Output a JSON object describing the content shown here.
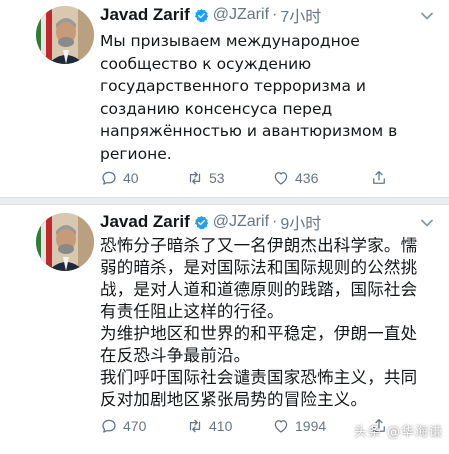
{
  "tweets": [
    {
      "author": {
        "name": "Javad Zarif",
        "handle": "@JZarif",
        "separator": "·",
        "time": "7小时"
      },
      "text": "Мы призываем международное\nсообщество к осуждению\nгосударственного терроризма и\nсозданию консенсуса перед\nнапряжённостью и авантюризмом в\nрегионе.",
      "counts": {
        "replies": "40",
        "retweets": "53",
        "likes": "436"
      }
    },
    {
      "author": {
        "name": "Javad Zarif",
        "handle": "@JZarif",
        "separator": "·",
        "time": "9小时"
      },
      "text": "恐怖分子暗杀了又一名伊朗杰出科学家。懦\n弱的暗杀，是对国际法和国际规则的公然挑\n战，是对人道和道德原则的践踏，国际社会\n有责任阻止这样的行径。\n为维护地区和世界的和平稳定，伊朗一直处\n在反恐斗争最前沿。\n我们呼吁国际社会谴责国家恐怖主义，共同\n反对加剧地区紧张局势的冒险主义。",
      "counts": {
        "replies": "470",
        "retweets": "410",
        "likes": "1994"
      }
    }
  ],
  "watermark": "头条 @华海谦",
  "colors": {
    "verified_badge": "#1da1f2",
    "muted_text": "#657786",
    "body_text": "#14171a",
    "divider": "#e9edf0"
  },
  "icons": [
    "verified-badge-icon",
    "chevron-down-icon",
    "reply-icon",
    "retweet-icon",
    "like-icon",
    "share-icon"
  ]
}
